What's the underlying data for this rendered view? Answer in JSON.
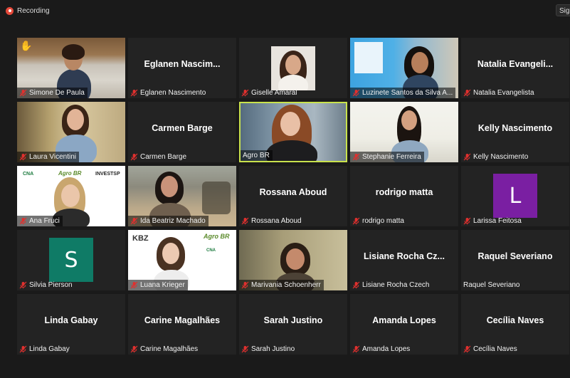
{
  "topbar": {
    "recording_label": "Recording",
    "signin_label": "Sign"
  },
  "participants": [
    {
      "name": "Simone De Paula",
      "type": "video"
    },
    {
      "name": "Eglanen Nascimento",
      "display": "Eglanen  Nascim...",
      "type": "name"
    },
    {
      "name": "Giselle Amaral",
      "type": "photo"
    },
    {
      "name": "Luzinete Santos da Silva A...",
      "type": "video"
    },
    {
      "name": "Natalia Evangelista",
      "display": "Natalia  Evangeli...",
      "type": "name"
    },
    {
      "name": "Laura Vicentini",
      "type": "video"
    },
    {
      "name": "Carmen Barge",
      "display": "Carmen Barge",
      "type": "name"
    },
    {
      "name": "Agro BR",
      "type": "video",
      "active": true
    },
    {
      "name": "Stephanie Ferreira",
      "type": "video"
    },
    {
      "name": "Kelly Nascimento",
      "display": "Kelly Nascimento",
      "type": "name"
    },
    {
      "name": "Ana Fruci",
      "type": "video",
      "logos": [
        "CNA",
        "Agro BR",
        "INVESTSP"
      ]
    },
    {
      "name": "Ida Beatriz Machado",
      "type": "video"
    },
    {
      "name": "Rossana Aboud",
      "display": "Rossana Aboud",
      "type": "name"
    },
    {
      "name": "rodrigo matta",
      "display": "rodrigo matta",
      "type": "name"
    },
    {
      "name": "Larissa Feitosa",
      "type": "avatar",
      "initial": "L",
      "color": "#7a1fa2"
    },
    {
      "name": "Silvia Pierson",
      "type": "avatar",
      "initial": "S",
      "color": "#0f7b66"
    },
    {
      "name": "Luana Krieger",
      "type": "video",
      "logos": [
        "KBZ",
        "Agro BR",
        "CNA"
      ]
    },
    {
      "name": "Marivania Schoenherr",
      "type": "video"
    },
    {
      "name": "Lisiane Rocha Czech",
      "display": "Lisiane  Rocha  Cz...",
      "type": "name"
    },
    {
      "name": "Raquel Severiano",
      "display": "Raquel Severiano",
      "type": "name",
      "no_mic": true
    },
    {
      "name": "Linda Gabay",
      "display": "Linda Gabay",
      "type": "name"
    },
    {
      "name": "Carine Magalhães",
      "display": "Carine Magalhães",
      "type": "name"
    },
    {
      "name": "Sarah Justino",
      "display": "Sarah Justino",
      "type": "name"
    },
    {
      "name": "Amanda Lopes",
      "display": "Amanda Lopes",
      "type": "name"
    },
    {
      "name": "Cecília Naves",
      "display": "Cecília Naves",
      "type": "name"
    }
  ],
  "colors": {
    "active_border": "#c9e24c",
    "mic_muted": "#e0302e",
    "recording": "#e5493a"
  },
  "icons": {
    "mic": "mic-muted-icon",
    "recording": "recording-icon",
    "raised_hand": "raised-hand-icon"
  }
}
